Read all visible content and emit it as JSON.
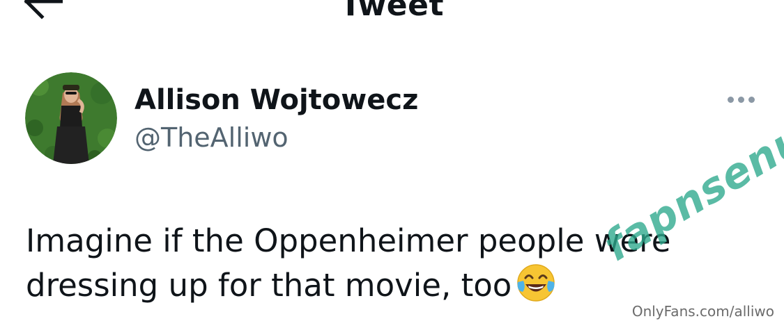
{
  "header": {
    "title": "Tweet"
  },
  "tweet": {
    "author_name": "Allison Wojtowecz",
    "author_handle": "@TheAlliwo",
    "text": "Imagine if the Oppenheimer people were dressing up for that movie, too",
    "emoji_icon": "face-with-tears-of-joy-icon"
  },
  "overlay": {
    "watermark": "fapnsenu.com",
    "source_credit": "OnlyFans.com/alliwo"
  },
  "colors": {
    "text_primary": "#0f1419",
    "text_secondary": "#536471",
    "more_dots": "#8b98a5",
    "watermark": "#2ca88c"
  }
}
